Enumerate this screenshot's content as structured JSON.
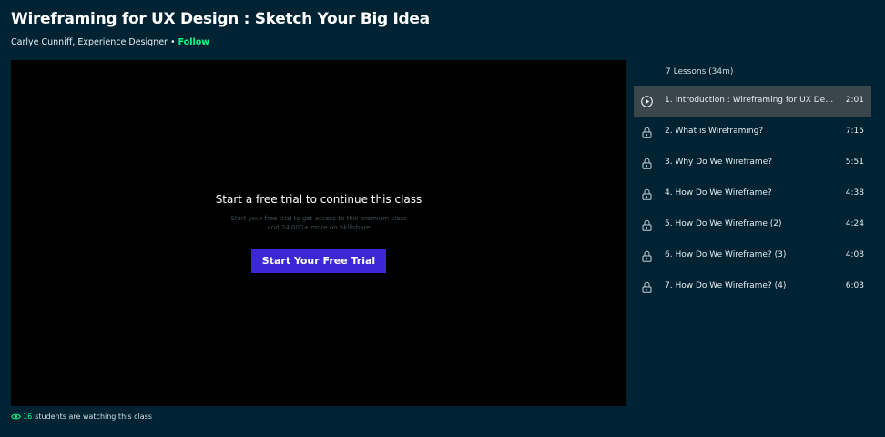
{
  "course": {
    "title": "Wireframing for UX Design : Sketch Your Big Idea",
    "instructor": "Carlye Cunniff, Experience Designer",
    "separator": "•",
    "follow_label": "Follow"
  },
  "player": {
    "trial_title": "Start a free trial to continue this class",
    "trial_subtitle": "Start your free trial to get access to this premium class and 24,000+ more on Skillshare",
    "trial_button_label": "Start Your Free Trial"
  },
  "watching": {
    "count": "16",
    "text": "students are watching this class"
  },
  "lessons": {
    "header": "7 Lessons (34m)",
    "items": [
      {
        "title": "1. Introduction : Wireframing for UX Design",
        "duration": "2:01",
        "icon": "play-icon",
        "active": true
      },
      {
        "title": "2. What is Wireframing?",
        "duration": "7:15",
        "icon": "lock-icon",
        "active": false
      },
      {
        "title": "3. Why Do We Wireframe?",
        "duration": "5:51",
        "icon": "lock-icon",
        "active": false
      },
      {
        "title": "4. How Do We Wireframe?",
        "duration": "4:38",
        "icon": "lock-icon",
        "active": false
      },
      {
        "title": "5. How Do We Wireframe (2)",
        "duration": "4:24",
        "icon": "lock-icon",
        "active": false
      },
      {
        "title": "6. How Do We Wireframe? (3)",
        "duration": "4:08",
        "icon": "lock-icon",
        "active": false
      },
      {
        "title": "7. How Do We Wireframe? (4)",
        "duration": "6:03",
        "icon": "lock-icon",
        "active": false
      }
    ]
  },
  "colors": {
    "background": "#002333",
    "accent_green": "#00ff84",
    "button_purple": "#3b27d6",
    "active_row": "#3a464c"
  }
}
